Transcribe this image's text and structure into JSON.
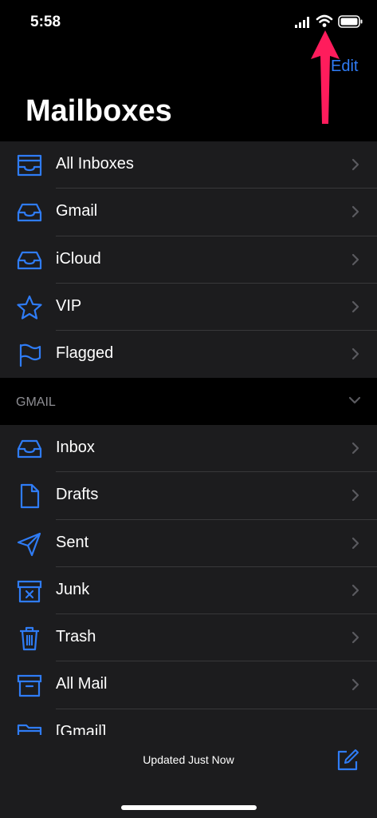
{
  "status_bar": {
    "time": "5:58"
  },
  "header": {
    "edit_label": "Edit",
    "title": "Mailboxes"
  },
  "mailboxes": [
    {
      "label": "All Inboxes",
      "icon": "all-inboxes-icon"
    },
    {
      "label": "Gmail",
      "icon": "inbox-tray-icon"
    },
    {
      "label": "iCloud",
      "icon": "inbox-tray-icon"
    },
    {
      "label": "VIP",
      "icon": "star-icon"
    },
    {
      "label": "Flagged",
      "icon": "flag-icon"
    }
  ],
  "gmail_section": {
    "header": "GMAIL",
    "items": [
      {
        "label": "Inbox",
        "icon": "inbox-tray-icon"
      },
      {
        "label": "Drafts",
        "icon": "document-icon"
      },
      {
        "label": "Sent",
        "icon": "paper-plane-icon"
      },
      {
        "label": "Junk",
        "icon": "junk-box-icon"
      },
      {
        "label": "Trash",
        "icon": "trash-icon"
      },
      {
        "label": "All Mail",
        "icon": "archive-box-icon"
      },
      {
        "label": "[Gmail]",
        "icon": "folder-icon"
      }
    ]
  },
  "toolbar": {
    "status_text": "Updated Just Now"
  },
  "colors": {
    "accent": "#2f7cf6",
    "annotation_arrow": "#ff1c5c",
    "row_background": "#1c1c1e"
  }
}
